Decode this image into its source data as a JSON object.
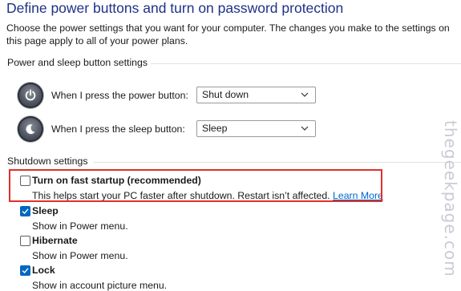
{
  "page": {
    "title": "Define power buttons and turn on password protection",
    "description": "Choose the power settings that you want for your computer. The changes you make to the settings on this page apply to all of your power plans."
  },
  "power_section": {
    "heading": "Power and sleep button settings",
    "power_button": {
      "label": "When I press the power button:",
      "value": "Shut down",
      "icon": "power-icon"
    },
    "sleep_button": {
      "label": "When I press the sleep button:",
      "value": "Sleep",
      "icon": "sleep-moon-icon"
    }
  },
  "shutdown_section": {
    "heading": "Shutdown settings",
    "options": [
      {
        "title": "Turn on fast startup (recommended)",
        "sub": "This helps start your PC faster after shutdown. Restart isn’t affected.",
        "link": "Learn More",
        "checked": false
      },
      {
        "title": "Sleep",
        "sub": "Show in Power menu.",
        "checked": true
      },
      {
        "title": "Hibernate",
        "sub": "Show in Power menu.",
        "checked": false
      },
      {
        "title": "Lock",
        "sub": "Show in account picture menu.",
        "checked": true
      }
    ]
  },
  "watermark": {
    "text": "thegeekpage.com"
  },
  "colors": {
    "title": "#1e3287",
    "checkbox_checked": "#0067c0",
    "highlight": "#e0302b",
    "link": "#0066cc"
  }
}
